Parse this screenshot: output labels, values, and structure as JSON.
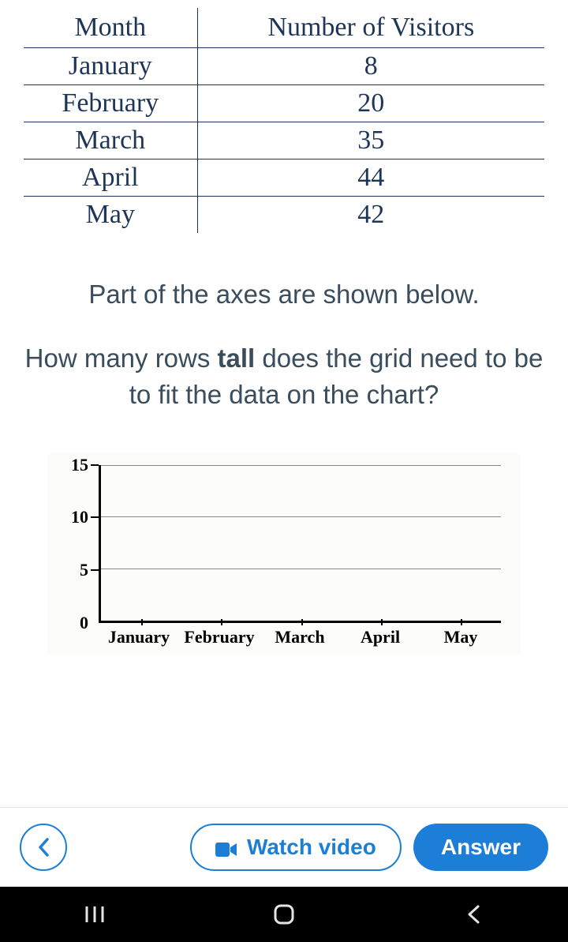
{
  "table": {
    "headers": [
      "Month",
      "Number of Visitors"
    ],
    "rows": [
      {
        "month": "January",
        "visitors": "8"
      },
      {
        "month": "February",
        "visitors": "20"
      },
      {
        "month": "March",
        "visitors": "35"
      },
      {
        "month": "April",
        "visitors": "44"
      },
      {
        "month": "May",
        "visitors": "42"
      }
    ]
  },
  "question": {
    "line1": "Part of the axes are shown below.",
    "line2_pre": "How many rows ",
    "line2_bold": "tall",
    "line2_post": " does the grid need to be to fit the data on the chart?"
  },
  "chart_data": {
    "type": "bar",
    "categories": [
      "January",
      "February",
      "March",
      "April",
      "May"
    ],
    "y_ticks": [
      "15",
      "10",
      "5",
      "0"
    ],
    "ylim": [
      0,
      15
    ],
    "y_interval": 5
  },
  "buttons": {
    "watch_video": "Watch video",
    "answer": "Answer"
  }
}
